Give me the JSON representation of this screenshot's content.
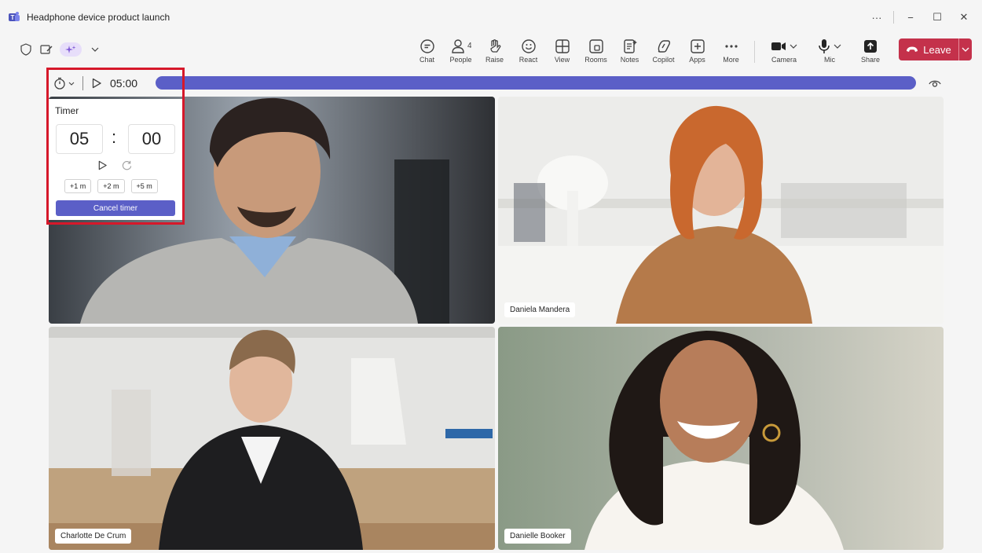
{
  "window": {
    "title": "Headphone device product launch",
    "controls": [
      "···",
      "−",
      "☐",
      "✕"
    ]
  },
  "toolbar": {
    "buttons": [
      {
        "label": "Chat",
        "icon": "chat-icon"
      },
      {
        "label": "People",
        "icon": "people-icon",
        "badge": "4"
      },
      {
        "label": "Raise",
        "icon": "raise-hand-icon"
      },
      {
        "label": "React",
        "icon": "react-icon"
      },
      {
        "label": "View",
        "icon": "view-icon"
      },
      {
        "label": "Rooms",
        "icon": "rooms-icon"
      },
      {
        "label": "Notes",
        "icon": "notes-icon"
      },
      {
        "label": "Copilot",
        "icon": "copilot-icon"
      },
      {
        "label": "Apps",
        "icon": "apps-icon"
      },
      {
        "label": "More",
        "icon": "more-icon"
      }
    ],
    "camera_label": "Camera",
    "mic_label": "Mic",
    "share_label": "Share",
    "leave_label": "Leave"
  },
  "timer_bar": {
    "time": "05:00",
    "progress": 1.0
  },
  "timer_popup": {
    "title": "Timer",
    "minutes": "05",
    "colon": ":",
    "seconds": "00",
    "add_buttons": [
      "+1 m",
      "+2 m",
      "+5 m"
    ],
    "cancel_label": "Cancel timer"
  },
  "participants": [
    {
      "name": ""
    },
    {
      "name": "Daniela Mandera"
    },
    {
      "name": "Charlotte De Crum"
    },
    {
      "name": "Danielle Booker"
    }
  ],
  "colors": {
    "accent": "#5b5fc7",
    "leave": "#c4314b",
    "highlight": "#d6182a"
  }
}
